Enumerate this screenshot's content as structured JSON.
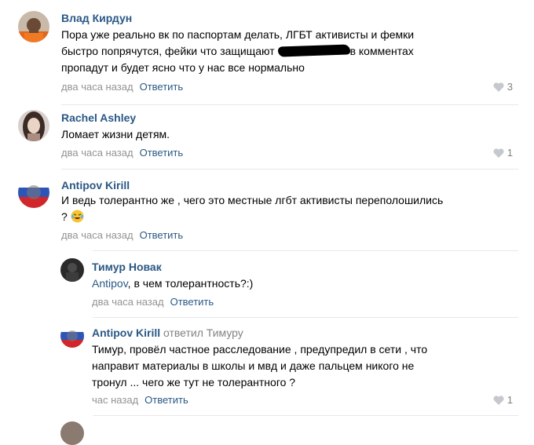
{
  "comments": [
    {
      "author": "Влад Кирдун",
      "text_lines": [
        "Пора уже реально вк по паспортам делать, ЛГБТ активисты и фемки",
        "быстро попрячутся, фейки что защищают",
        "в комментах",
        "пропадут и будет ясно что у нас все нормально"
      ],
      "time": "два часа назад",
      "reply_label": "Ответить",
      "likes": "3"
    },
    {
      "author": "Rachel Ashley",
      "text_lines": [
        "Ломает жизни детям."
      ],
      "time": "два часа назад",
      "reply_label": "Ответить",
      "likes": "1"
    },
    {
      "author": "Antipov Kirill",
      "text_lines": [
        "И ведь толерантно же , чего это местные лгбт активисты переполошились",
        "?"
      ],
      "emoji": "laughing-tears-emoji",
      "time": "два часа назад",
      "reply_label": "Ответить",
      "likes": ""
    },
    {
      "author": "Тимур Новак",
      "mention": "Antipov",
      "text_rest": ", в чем толерантность?:)",
      "time": "два часа назад",
      "reply_label": "Ответить",
      "likes": ""
    },
    {
      "author": "Antipov Kirill",
      "reply_note": "ответил Тимуру",
      "text_lines": [
        "Тимур, провёл частное расследование , предупредил в сети , что",
        "направит материалы в школы и мвд и даже пальцем никого не",
        "тронул ... чего же тут не толерантного ?"
      ],
      "time": "час назад",
      "reply_label": "Ответить",
      "likes": "1"
    }
  ],
  "colors": {
    "link": "#2a5885",
    "muted": "#939393",
    "divider": "#e7e8ec"
  }
}
